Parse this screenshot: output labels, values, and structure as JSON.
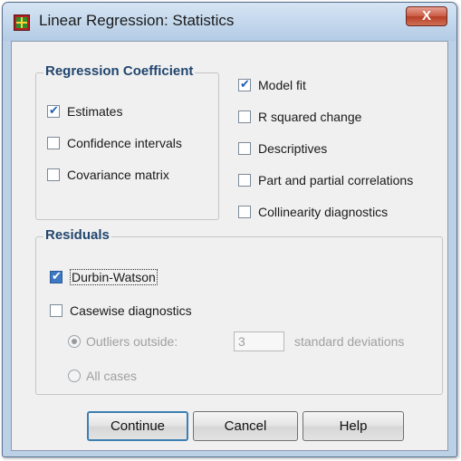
{
  "window": {
    "title": "Linear Regression: Statistics",
    "close_glyph": "X",
    "app_icon": "spss-grid-icon"
  },
  "regression_coefficient": {
    "title": "Regression Coefficient",
    "items": [
      {
        "label": "Estimates",
        "checked": true
      },
      {
        "label": "Confidence intervals",
        "checked": false
      },
      {
        "label": "Covariance matrix",
        "checked": false
      }
    ]
  },
  "right_options": [
    {
      "label": "Model fit",
      "checked": true
    },
    {
      "label": "R squared change",
      "checked": false
    },
    {
      "label": "Descriptives",
      "checked": false
    },
    {
      "label": "Part and partial correlations",
      "checked": false
    },
    {
      "label": "Collinearity diagnostics",
      "checked": false
    }
  ],
  "residuals": {
    "title": "Residuals",
    "durbin_watson": {
      "label": "Durbin-Watson",
      "checked": true
    },
    "casewise": {
      "label": "Casewise diagnostics",
      "checked": false
    },
    "outliers": {
      "label": "Outliers outside:",
      "selected": true,
      "value": "3",
      "suffix": "standard deviations"
    },
    "all_cases": {
      "label": "All cases",
      "selected": false
    }
  },
  "buttons": {
    "continue": "Continue",
    "cancel": "Cancel",
    "help": "Help"
  }
}
